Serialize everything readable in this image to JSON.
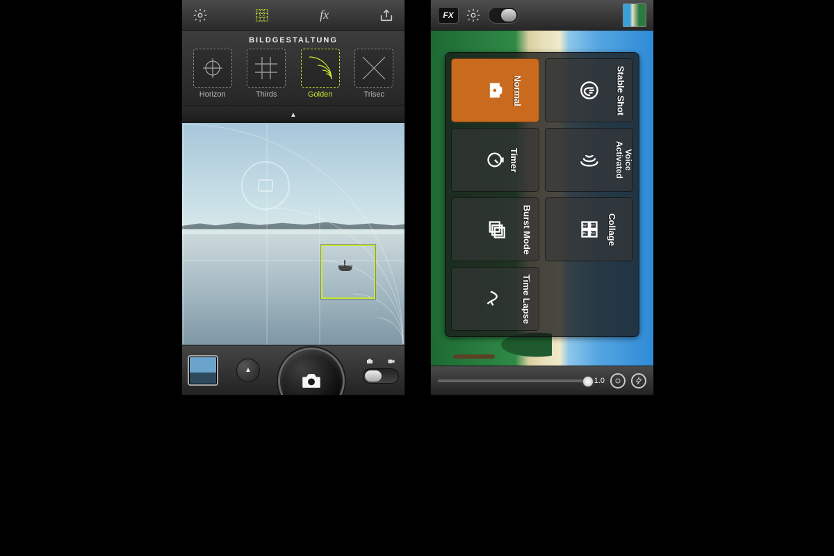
{
  "left": {
    "grid_panel": {
      "title": "BILDGESTALTUNG",
      "options": [
        {
          "id": "horizon",
          "label": "Horizon"
        },
        {
          "id": "thirds",
          "label": "Thirds"
        },
        {
          "id": "golden",
          "label": "Golden"
        },
        {
          "id": "trisec",
          "label": "Trisec"
        }
      ],
      "active": "golden"
    },
    "toolbar": {
      "settings_icon": "gear",
      "grid_icon": "grid",
      "fx_label": "fx",
      "share_icon": "share"
    },
    "bottom": {
      "mode_toggle_photo": "photo",
      "mode_toggle_video": "video"
    }
  },
  "right": {
    "toolbar": {
      "fx_label": "FX"
    },
    "modes": {
      "col1": [
        {
          "id": "normal",
          "label": "Normal",
          "active": true
        },
        {
          "id": "timer",
          "label": "Timer"
        },
        {
          "id": "burst",
          "label": "Burst Mode"
        },
        {
          "id": "timelapse",
          "label": "Time Lapse"
        }
      ],
      "col2": [
        {
          "id": "stable",
          "label": "Stable Shot"
        },
        {
          "id": "voice",
          "label": "Voice Activated",
          "two_line": "Voice\nActivated"
        },
        {
          "id": "collage",
          "label": "Collage"
        }
      ]
    },
    "zoom_label": "1.0"
  }
}
